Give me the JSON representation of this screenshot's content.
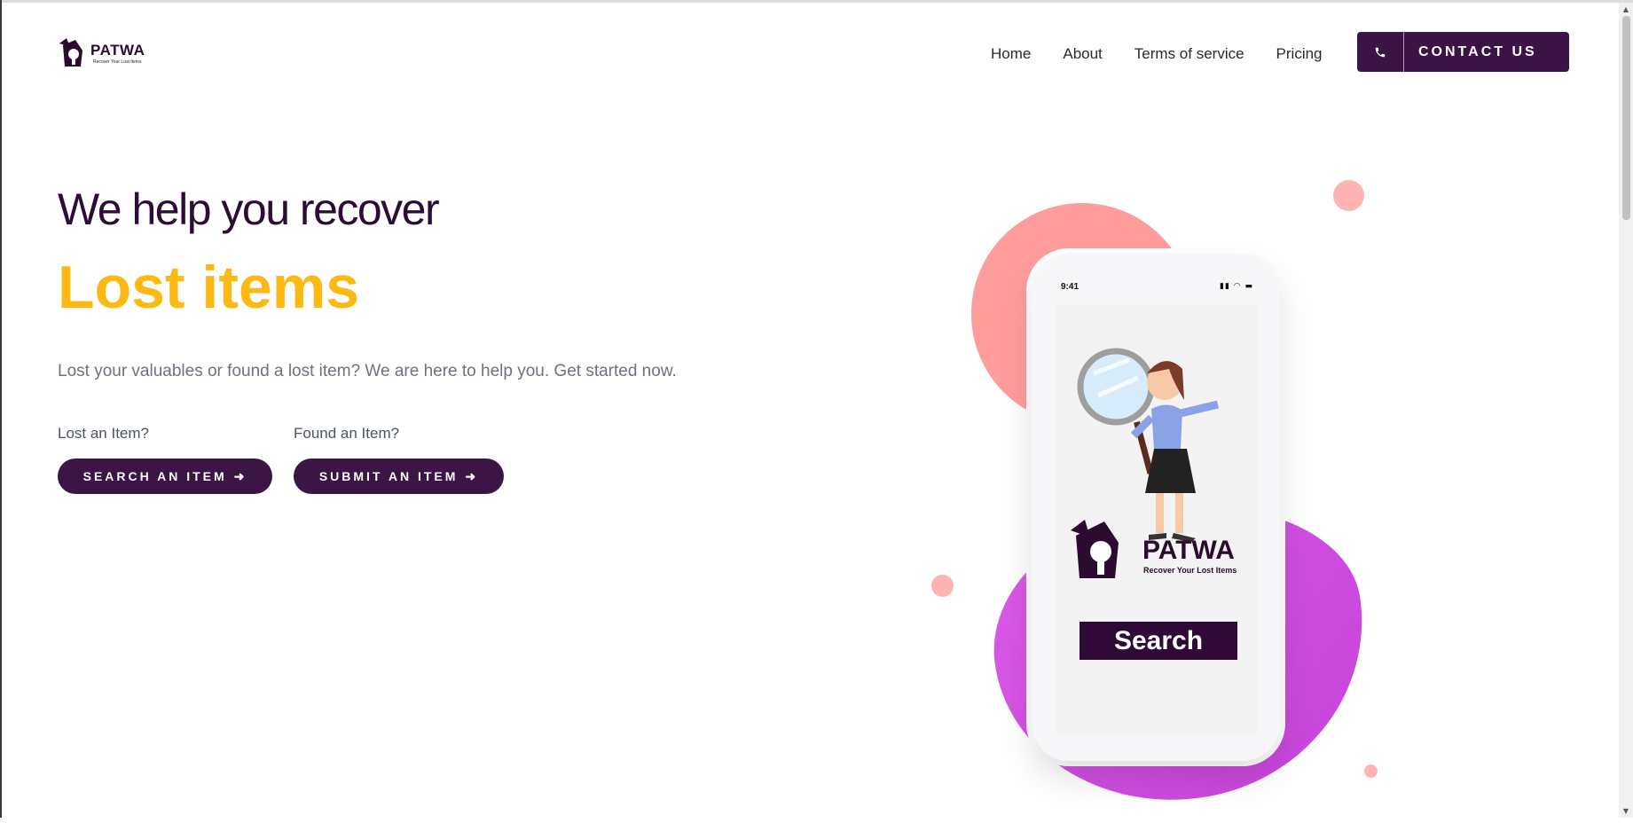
{
  "header": {
    "logo_brand": "PATWA",
    "logo_tagline": "Recover Your Lost Items",
    "nav": [
      "Home",
      "About",
      "Terms of service",
      "Pricing"
    ],
    "contact_label": "CONTACT US",
    "contact_icon": "phone-icon"
  },
  "hero": {
    "title": "We help you recover",
    "subtitle": "Lost items",
    "description": "Lost your valuables or found a lost item? We are here to help you. Get started now.",
    "lost_label": "Lost an Item?",
    "search_button": "SEARCH AN ITEM",
    "found_label": "Found an Item?",
    "submit_button": "SUBMIT AN ITEM",
    "arrow_icon": "arrow-right-icon"
  },
  "illustration": {
    "phone_time": "9:41",
    "app_brand": "PATWA",
    "app_tagline": "Recover Your Lost Items",
    "search_label": "Search"
  },
  "colors": {
    "primary": "#3b1346",
    "accent": "#fdb913",
    "pink": "#ff9d9d",
    "magenta": "#d44de3"
  }
}
